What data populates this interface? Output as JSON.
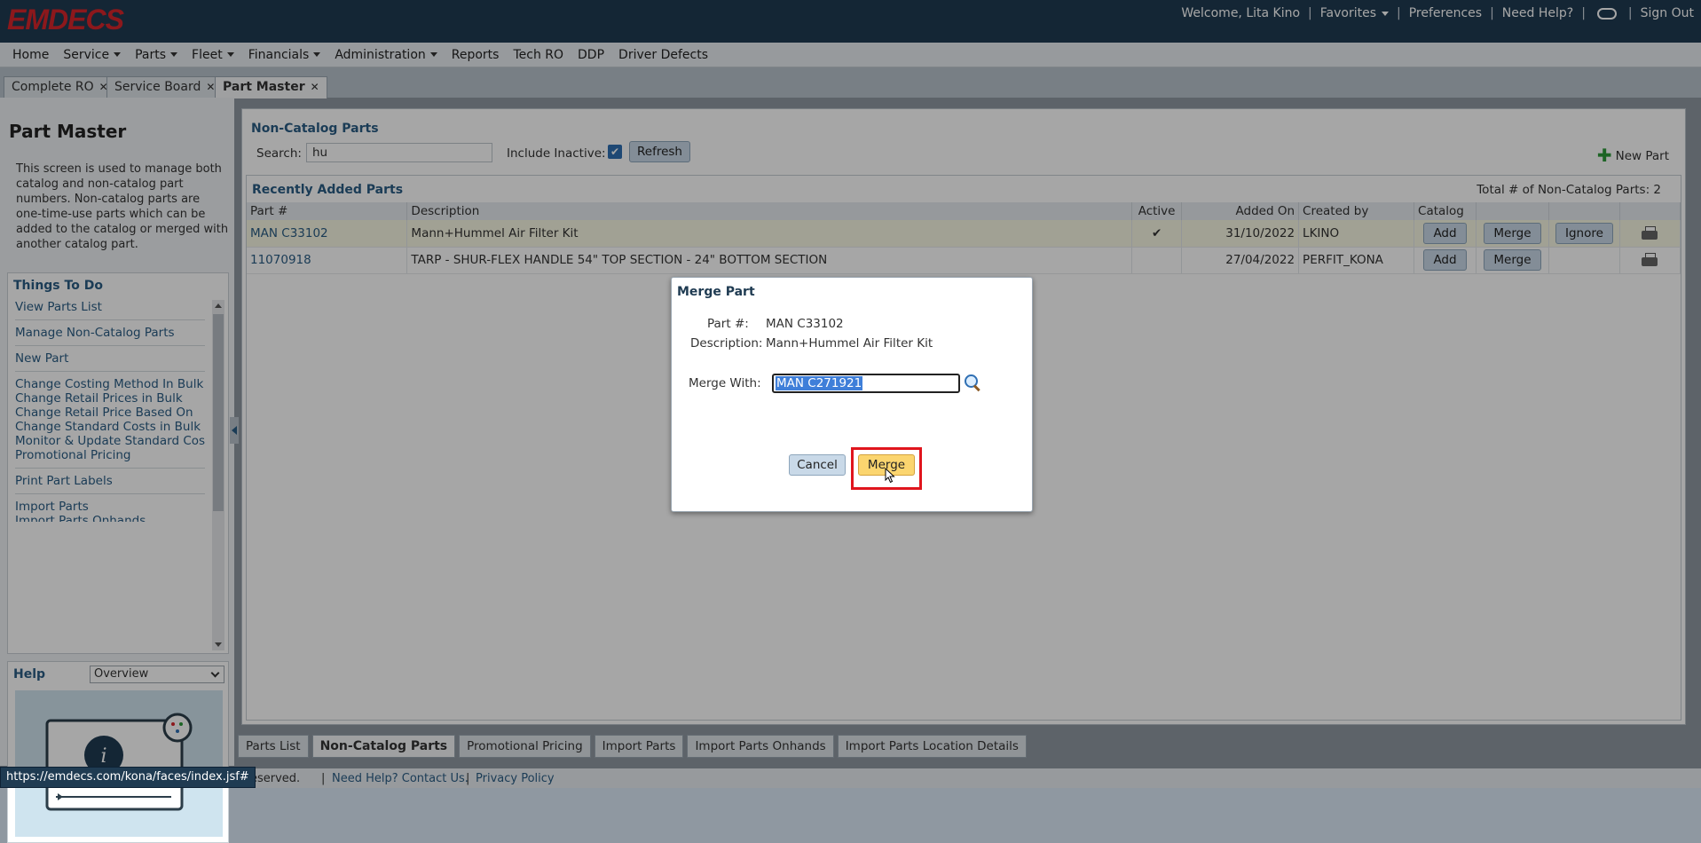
{
  "header": {
    "logo": "EMDECS",
    "welcome": "Welcome, Lita Kino",
    "favorites": "Favorites",
    "preferences": "Preferences",
    "need_help": "Need Help?",
    "sign_out": "Sign Out"
  },
  "menu": {
    "items": [
      "Home",
      "Service",
      "Parts",
      "Fleet",
      "Financials",
      "Administration",
      "Reports",
      "Tech RO",
      "DDP",
      "Driver Defects"
    ]
  },
  "tabs": [
    "Complete RO",
    "Service Board",
    "Part Master"
  ],
  "left": {
    "title": "Part Master",
    "description": "This screen is used to manage both catalog and non-catalog part numbers. Non-catalog parts are one-time-use parts which can be added to the catalog or merged with another catalog part.",
    "todo_title": "Things To Do",
    "todo_items": [
      "View Parts List",
      "Manage Non-Catalog Parts",
      "New Part",
      "Change Costing Method In Bulk",
      "Change Retail Prices in Bulk",
      "Change Retail Price Based On",
      "Change Standard Costs in Bulk",
      "Monitor & Update Standard Costs",
      "Promotional Pricing",
      "Print Part Labels",
      "Import Parts",
      "Import Parts Onhands"
    ],
    "help_title": "Help",
    "help_selected": "Overview"
  },
  "main": {
    "section_title": "Non-Catalog Parts",
    "search_label": "Search:",
    "search_value": "hu",
    "include_inactive_label": "Include Inactive:",
    "refresh_label": "Refresh",
    "new_part_label": "New Part",
    "recent_title": "Recently Added Parts",
    "total_label": "Total # of Non-Catalog Parts:  2",
    "columns": [
      "Part #",
      "Description",
      "Active",
      "Added On",
      "Created by",
      "Catalog"
    ],
    "rows": [
      {
        "part": "MAN C33102",
        "description": "Mann+Hummel Air Filter Kit",
        "active": "✔",
        "added_on": "31/10/2022",
        "created_by": "LKINO"
      },
      {
        "part": "11070918",
        "description": "TARP - SHUR-FLEX HANDLE 54\" TOP SECTION - 24\" BOTTOM SECTION",
        "active": "",
        "added_on": "27/04/2022",
        "created_by": "PERFIT_KONA"
      }
    ],
    "add_label": "Add",
    "merge_label": "Merge",
    "ignore_label": "Ignore"
  },
  "bottom_tabs": [
    "Parts List",
    "Non-Catalog Parts",
    "Promotional Pricing",
    "Import Parts",
    "Import Parts Onhands",
    "Import Parts Location Details"
  ],
  "footer": {
    "rights": "eserved.",
    "help": "Need Help? Contact Us.",
    "privacy": "Privacy Policy",
    "status_url": "https://emdecs.com/kona/faces/index.jsf#"
  },
  "modal": {
    "title": "Merge Part",
    "part_label": "Part #:",
    "part_value": "MAN C33102",
    "desc_label": "Description:",
    "desc_value": "Mann+Hummel Air Filter Kit",
    "merge_with_label": "Merge With:",
    "merge_with_value": "MAN C271921",
    "cancel_label": "Cancel",
    "merge_label": "Merge"
  },
  "colors": {
    "header_bg": "#1f3b52",
    "logo": "#d8262b",
    "link": "#2a5d85",
    "highlight_button": "#fbd56f",
    "focus_box": "#e0151d"
  }
}
